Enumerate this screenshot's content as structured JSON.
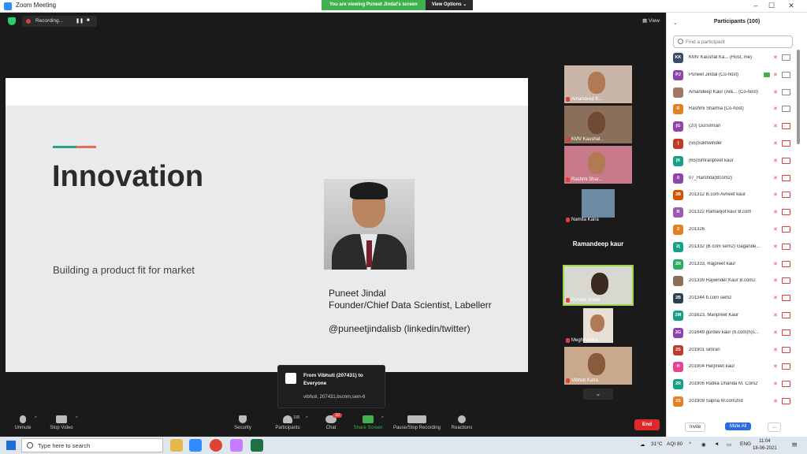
{
  "window": {
    "title": "Zoom Meeting",
    "minimize": "–",
    "maximize": "☐",
    "close": "✕"
  },
  "banner": {
    "message": "You are viewing Puneet Jindal's screen",
    "view_options": "View Options ⌄"
  },
  "recording": {
    "label": "Recording...",
    "pause": "❚❚",
    "stop": "■"
  },
  "view_button": "▦ View",
  "slide": {
    "heading": "Innovation",
    "subtitle": "Building a product fit for market",
    "speaker_name": "Puneet Jindal",
    "speaker_role": "Founder/Chief Data Scientist, Labellerr",
    "speaker_handle": "@puneetjindalisb (linkedin/twitter)"
  },
  "thumbnails": [
    {
      "label": "Amandeep K...",
      "bg": "#c9b6a8"
    },
    {
      "label": "KMV Kaushal...",
      "bg": "#8a6f5a"
    },
    {
      "label": "Rashmi Shar...",
      "bg": "#c97a8a"
    },
    {
      "label": "Namita Kalra",
      "bg": "#6d8aa5"
    },
    {
      "label": "Ramandeep kaur",
      "bg": "#1a1a1a"
    },
    {
      "label": "Puneet Jindal",
      "bg": "#d8d8d0"
    },
    {
      "label": "Meghil Arora",
      "bg": "#e8e0d6"
    },
    {
      "label": "Vibhuti Kalra",
      "bg": "#c8a98e"
    }
  ],
  "scroll_down": "⌄",
  "chat_popup": {
    "from": "From Vibhuti (207431) to Everyone",
    "message": "vibhuti, 207431,bscnm,sem-6"
  },
  "toolbar": {
    "unmute": "Unmute",
    "stop_video": "Stop Video",
    "security": "Security",
    "participants": "Participants",
    "participants_count": "100",
    "chat": "Chat",
    "chat_badge": "10",
    "share_screen": "Share Screen",
    "pause_recording": "Pause/Stop Recording",
    "reactions": "Reactions",
    "end": "End",
    "caret": "^"
  },
  "participants_panel": {
    "title": "Participants (100)",
    "collapse": "⌄",
    "search_placeholder": "Find a participant",
    "invite": "Invite",
    "mute_all": "Mute All",
    "more": "...",
    "rows": [
      {
        "initials": "KK",
        "name": "KMV Kaushal Ka... (Host, me)",
        "color": "#3b4a66",
        "cam_on": true
      },
      {
        "initials": "PJ",
        "name": "Puneet Jindal (Co-host)",
        "color": "#8e44ad",
        "cam_on": true,
        "sharing": true
      },
      {
        "initials": "",
        "name": "Amandeep Kaur (Ai&... (Co-host)",
        "color": "#a07a60",
        "cam_on": true
      },
      {
        "initials": "R",
        "name": "Rashmi Sharma (Co-host)",
        "color": "#e67e22",
        "cam_on": true
      },
      {
        "initials": "(G",
        "name": "(20) Gursimran",
        "color": "#8e44ad",
        "cam_on": false
      },
      {
        "initials": "(",
        "name": "(55)Sukhwinder",
        "color": "#c0392b",
        "cam_on": false
      },
      {
        "initials": "(K",
        "name": "(65)Simranpreet kaur",
        "color": "#16a085",
        "cam_on": false
      },
      {
        "initials": "0",
        "name": "07_Harshita(Bcom2)",
        "color": "#8e44ad",
        "cam_on": false
      },
      {
        "initials": "2B",
        "name": "201312 B.com Avneet kaur",
        "color": "#d35400",
        "cam_on": false
      },
      {
        "initials": "R",
        "name": "201322 Ramanjot kaur B.com",
        "color": "#9b59b6",
        "cam_on": false
      },
      {
        "initials": "2",
        "name": "201326",
        "color": "#e67e22",
        "cam_on": false
      },
      {
        "initials": "2(",
        "name": "201332 (B.com sem2) Gagande...",
        "color": "#16a085",
        "cam_on": false
      },
      {
        "initials": "2R",
        "name": "201333, Rajpreet kaur",
        "color": "#27ae60",
        "cam_on": false
      },
      {
        "initials": "",
        "name": "201339 Rajwinder Kaur B.com2",
        "color": "#8a6f5a",
        "cam_on": false
      },
      {
        "initials": "2B",
        "name": "201344 b.com sem2",
        "color": "#2c3e50",
        "cam_on": false
      },
      {
        "initials": "2M",
        "name": "201623, Manpreet Kaur",
        "color": "#16a085",
        "cam_on": false
      },
      {
        "initials": "2G",
        "name": "201649 gurdev kaur (b.com(h)s...",
        "color": "#8e44ad",
        "cam_on": false
      },
      {
        "initials": "2S",
        "name": "201901 simran",
        "color": "#c0392b",
        "cam_on": false
      },
      {
        "initials": "H",
        "name": "201904 Harpreet kaur",
        "color": "#e84393",
        "cam_on": false
      },
      {
        "initials": "2R",
        "name": "201905 Ratika Dhanda M. Com2",
        "color": "#16a085",
        "cam_on": false
      },
      {
        "initials": "2S",
        "name": "201909 Sapna M.com2nd",
        "color": "#e67e22",
        "cam_on": false
      }
    ]
  },
  "taskbar": {
    "search_placeholder": "Type here to search",
    "weather": "31°C",
    "aqi": "AQI 80",
    "language": "ENG",
    "time": "11:04",
    "date": "18-06-2021"
  }
}
